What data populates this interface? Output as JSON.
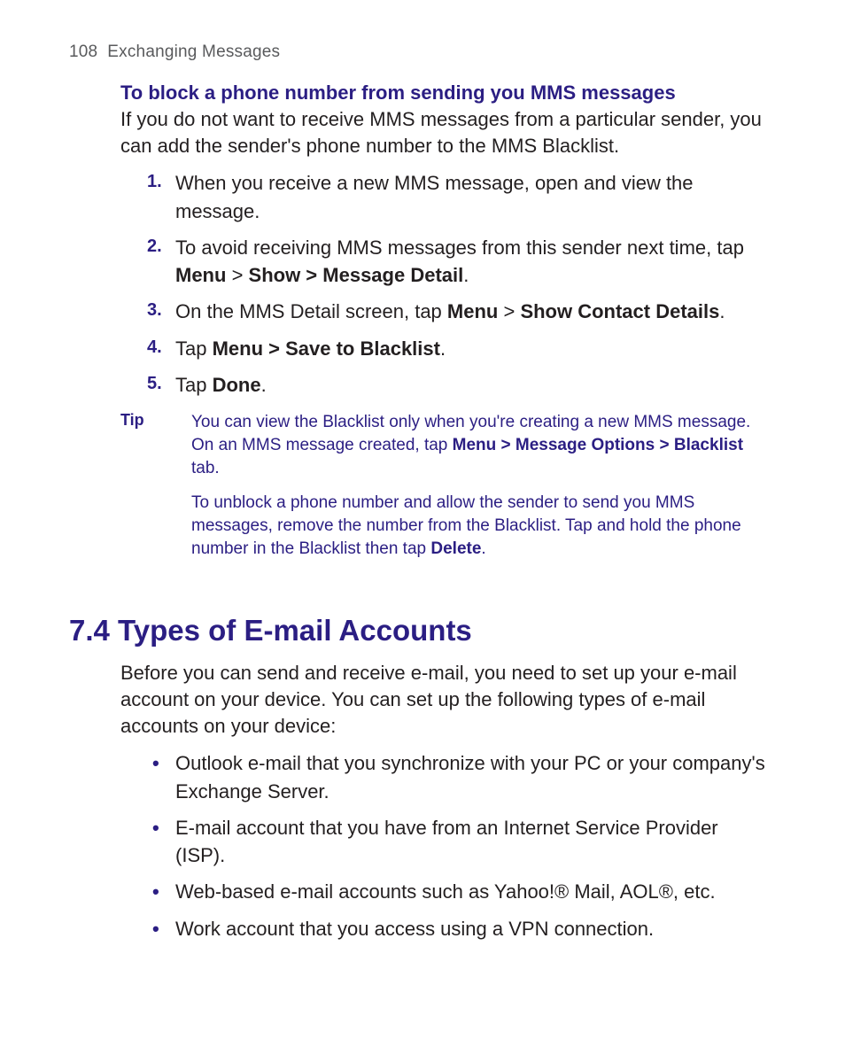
{
  "header": {
    "page_number": "108",
    "chapter": "Exchanging Messages"
  },
  "section1": {
    "heading": "To block a phone number from sending you MMS messages",
    "intro": "If you do not want to receive MMS messages from a particular sender, you can add the sender's phone number to the MMS Blacklist.",
    "steps": [
      {
        "n": "1.",
        "pre": "When you receive a new MMS message, open and view the message."
      },
      {
        "n": "2.",
        "pre": "To avoid receiving MMS messages from this sender next time, tap ",
        "bold": "Menu",
        "mid1": " > ",
        "bold2": "Show > Message Detail",
        "post": "."
      },
      {
        "n": "3.",
        "pre": "On the MMS Detail screen, tap ",
        "bold": "Menu",
        "mid1": " > ",
        "bold2": "Show Contact Details",
        "post": "."
      },
      {
        "n": "4.",
        "pre": "Tap ",
        "bold": "Menu > Save to Blacklist",
        "post": "."
      },
      {
        "n": "5.",
        "pre": "Tap ",
        "bold": "Done",
        "post": "."
      }
    ],
    "tip_label": "Tip",
    "tip_p1_a": "You can view the Blacklist only when you're creating a new MMS message. On an MMS message created, tap ",
    "tip_p1_b": "Menu > Message Options > Blacklist",
    "tip_p1_c": " tab.",
    "tip_p2_a": "To unblock a phone number and allow the sender to send you MMS messages, remove the number from the Blacklist. Tap and hold the phone number in the Blacklist then tap ",
    "tip_p2_b": "Delete",
    "tip_p2_c": "."
  },
  "section2": {
    "heading": "7.4 Types of E-mail Accounts",
    "intro": "Before you can send and receive e-mail, you need to set up your e-mail account on your device. You can set up the following types of e-mail accounts on your device:",
    "bullets": [
      "Outlook e-mail that you synchronize with your PC or your company's Exchange Server.",
      "E-mail account that you have from an Internet Service Provider (ISP).",
      "Web-based e-mail accounts such as Yahoo!® Mail, AOL®, etc.",
      "Work account that you access using a VPN connection."
    ]
  }
}
